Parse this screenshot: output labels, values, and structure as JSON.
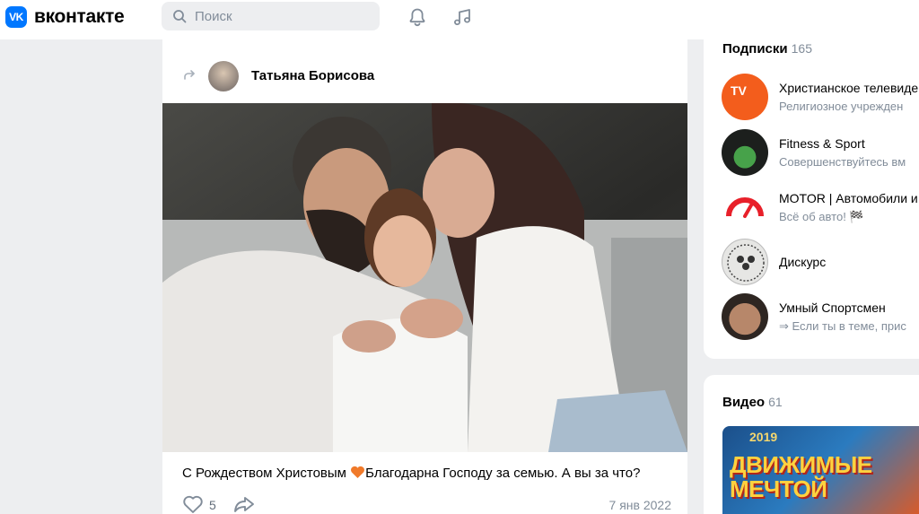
{
  "header": {
    "logo_mark": "VK",
    "logo_text": "вконтакте",
    "search_placeholder": "Поиск"
  },
  "post": {
    "author": "Татьяна Борисова",
    "text": "С Рождеством Христовым",
    "text_after_emoji": "Благодарна Господу за семью. А вы за что?",
    "likes": "5",
    "date": "7 янв 2022"
  },
  "subscriptions": {
    "title": "Подписки",
    "count": "165",
    "items": [
      {
        "name": "Христианское телевиде",
        "desc": "Религиозное учрежден",
        "avatar_label": "TV"
      },
      {
        "name": "Fitness & Sport",
        "desc": "Совершенствуйтесь вм"
      },
      {
        "name": "MOTOR | Автомобили и",
        "desc": "Всё об авто! 🏁"
      },
      {
        "name": "Дискурс",
        "desc": ""
      },
      {
        "name": "Умный Спортсмен",
        "desc": "⇒ Если ты в теме, прис"
      }
    ]
  },
  "videos": {
    "title": "Видео",
    "count": "61",
    "thumb_text": "ДВИЖИМЫЕ МЕЧТОЙ",
    "thumb_year": "2019"
  },
  "colors": {
    "brand": "#0077ff",
    "background": "#edeef0",
    "secondary_text": "#818c99"
  }
}
